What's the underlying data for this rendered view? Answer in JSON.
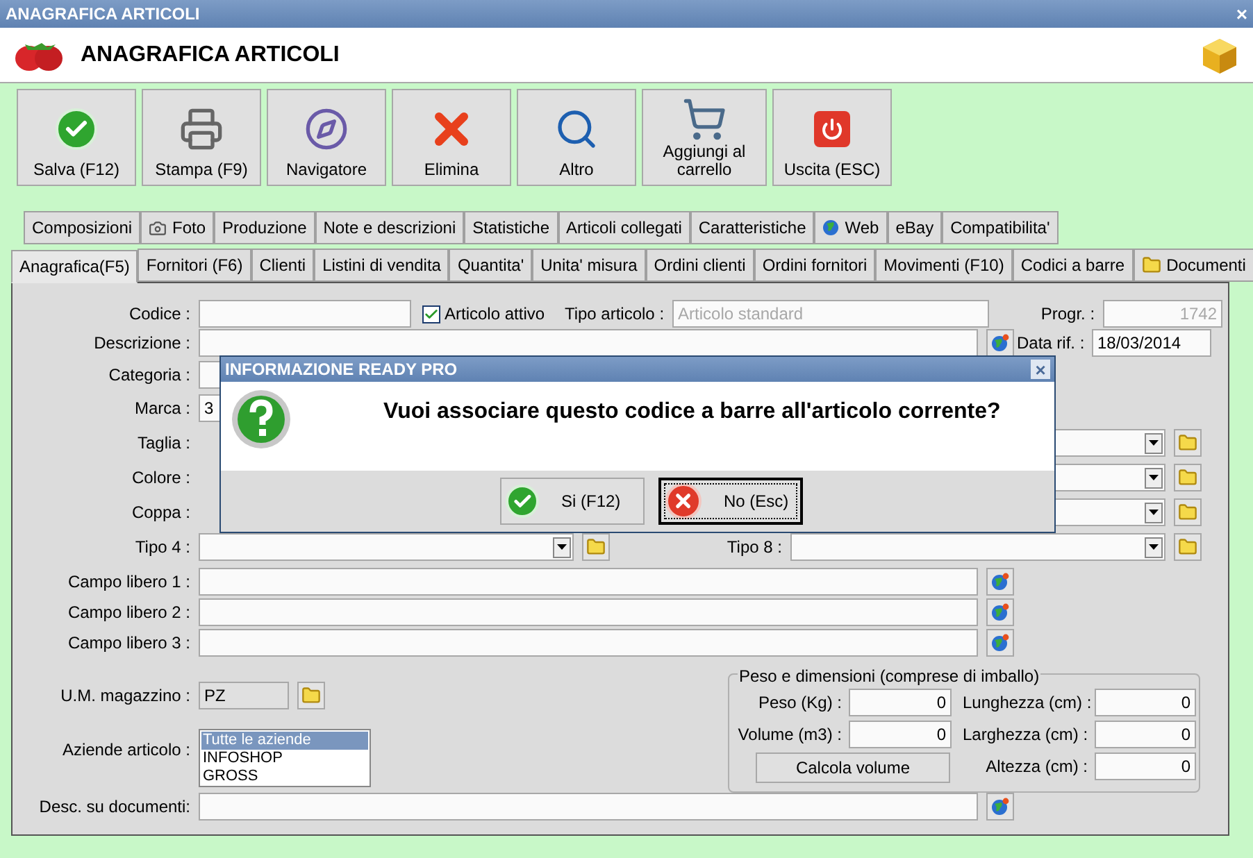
{
  "window": {
    "title": "ANAGRAFICA ARTICOLI",
    "close": "×"
  },
  "header": {
    "title": "ANAGRAFICA ARTICOLI"
  },
  "toolbar": [
    {
      "label": "Salva (F12)",
      "kind": "save"
    },
    {
      "label": "Stampa (F9)",
      "kind": "print"
    },
    {
      "label": "Navigatore",
      "kind": "compass"
    },
    {
      "label": "Elimina",
      "kind": "delete"
    },
    {
      "label": "Altro",
      "kind": "search"
    },
    {
      "label": "Aggiungi al carrello",
      "kind": "cart"
    },
    {
      "label": "Uscita (ESC)",
      "kind": "exit"
    }
  ],
  "tabs_row_1": [
    {
      "label": "Composizioni",
      "selected": false
    },
    {
      "label": "Foto",
      "kind": "camera",
      "selected": false
    },
    {
      "label": "Produzione",
      "selected": false
    },
    {
      "label": "Note e descrizioni",
      "selected": false
    },
    {
      "label": "Statistiche",
      "selected": false
    },
    {
      "label": "Articoli collegati",
      "selected": false
    },
    {
      "label": "Caratteristiche",
      "selected": false
    },
    {
      "label": "Web",
      "kind": "globe",
      "selected": false
    },
    {
      "label": "eBay",
      "selected": false
    },
    {
      "label": "Compatibilita'",
      "selected": false
    }
  ],
  "tabs_row_2": [
    {
      "label": "Anagrafica(F5)",
      "selected": true
    },
    {
      "label": "Fornitori (F6)",
      "selected": false
    },
    {
      "label": "Clienti",
      "selected": false
    },
    {
      "label": "Listini di vendita",
      "selected": false
    },
    {
      "label": "Quantita'",
      "selected": false
    },
    {
      "label": "Unita' misura",
      "selected": false
    },
    {
      "label": "Ordini clienti",
      "selected": false
    },
    {
      "label": "Ordini fornitori",
      "selected": false
    },
    {
      "label": "Movimenti (F10)",
      "selected": false
    },
    {
      "label": "Codici a barre",
      "selected": false
    },
    {
      "label": "Documenti",
      "kind": "folder",
      "selected": false
    }
  ],
  "form": {
    "codice": {
      "label": "Codice :"
    },
    "articolo_attivo": {
      "label": "Articolo attivo",
      "checked": true
    },
    "tipo_articolo": {
      "label": "Tipo articolo :",
      "value": "Articolo standard",
      "disabled": true
    },
    "progr": {
      "label": "Progr. :",
      "value": "1742",
      "disabled": true
    },
    "descrizione": {
      "label": "Descrizione :"
    },
    "data_rif": {
      "label": "Data rif. :",
      "value": "18/03/2014"
    },
    "categoria": {
      "label": "Categoria :"
    },
    "marca": {
      "label": "Marca :",
      "value": "3"
    },
    "combo_rows": [
      {
        "left_label": "Taglia :"
      },
      {
        "left_label": "Colore :"
      },
      {
        "left_label": "Coppa :"
      },
      {
        "left_label": "Tipo 4 :",
        "right_label": "Tipo 8 :"
      }
    ],
    "campi_liberi": [
      {
        "label": "Campo libero 1 :"
      },
      {
        "label": "Campo libero 2 :"
      },
      {
        "label": "Campo libero 3 :"
      }
    ],
    "um_magazzino": {
      "label": "U.M. magazzino :",
      "value": "PZ"
    },
    "aziende": {
      "label": "Aziende articolo :",
      "items": [
        {
          "label": "Tutte le aziende",
          "selected": true
        },
        {
          "label": "INFOSHOP",
          "selected": false
        },
        {
          "label": "GROSS",
          "selected": false
        }
      ]
    },
    "peso_dimensioni": {
      "title": "Peso e dimensioni (comprese di imballo)",
      "peso": {
        "label": "Peso (Kg) :",
        "value": "0"
      },
      "volume": {
        "label": "Volume (m3) :",
        "value": "0"
      },
      "calcola": "Calcola volume",
      "lunghezza": {
        "label": "Lunghezza (cm) :",
        "value": "0"
      },
      "larghezza": {
        "label": "Larghezza (cm) :",
        "value": "0"
      },
      "altezza": {
        "label": "Altezza (cm) :",
        "value": "0"
      }
    },
    "desc_documenti": {
      "label": "Desc. su documenti:"
    }
  },
  "dialog": {
    "title": "INFORMAZIONE READY PRO",
    "close": "×",
    "message": "Vuoi associare questo codice a barre all'articolo corrente?",
    "buttons": [
      {
        "label": "Si (F12)",
        "kind": "yes",
        "focused": false
      },
      {
        "label": "No (Esc)",
        "kind": "no",
        "focused": true
      }
    ]
  }
}
